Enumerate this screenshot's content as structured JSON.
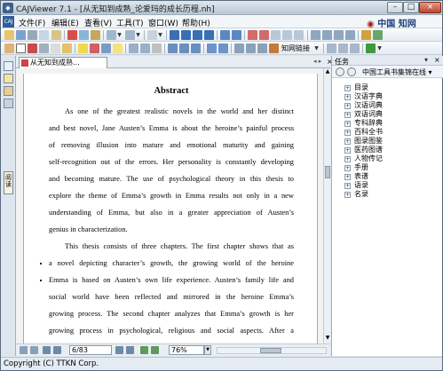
{
  "window": {
    "title": "CAJViewer 7.1 - [从无知到成熟_论爱玛的成长历程.nh]",
    "controls": [
      "–",
      "□",
      "×"
    ]
  },
  "menu": {
    "items": [
      "文件(F)",
      "编辑(E)",
      "查看(V)",
      "工具(T)",
      "窗口(W)",
      "帮助(H)"
    ],
    "brand_cn": "中国",
    "brand_cn2": "知网"
  },
  "toolbar": {
    "hyperlink_label": "知网链接"
  },
  "document": {
    "tab_title": "从无知到成熟...",
    "close_label": "×",
    "nav_label": "◂ ▸",
    "heading": "Abstract",
    "lines": [
      "As one of the greatest realistic novels in the world and her distinct",
      "and best novel, Jane Austen’s Emma is about the heroine’s painful process",
      "of removing illusion into mature and emotional maturity and gaining",
      "self-recognition out of the errors. Her personality is constantly developing",
      "and becoming mature. The use of psychological theory in this thesis to",
      "explore the theme of Emma’s growth in Emma results not only in a new",
      "understanding of Emma, but also in a greater appreciation of Austen’s",
      "genius in characterization.",
      "This thesis consists of three chapters. The first chapter shows that as",
      "a novel depicting character’s growth, the growing world of the heroine",
      "Emma is based on Austen’s own life experience. Austen’s family life and",
      "social world have been reflected and mirrored in the heroine Emma’s",
      "growing process. The second chapter analyzes that Emma’s growth is her",
      "growing process in psychological, religious and social aspects. After a"
    ]
  },
  "left_strip": {
    "read_tab": "阅读"
  },
  "task_panel": {
    "title": "任务",
    "pin": "▾",
    "close": "×",
    "selector": "中国工具书集锦在线 ▾",
    "tree": [
      "目录",
      "汉语字典",
      "汉语词典",
      "双语词典",
      "专科辞典",
      "百科全书",
      "图录图鉴",
      "医药图谱",
      "人物传记",
      "手册",
      "表谱",
      "语录",
      "名录"
    ]
  },
  "navigation": {
    "page_value": "6/83",
    "zoom_value": "76%"
  },
  "status": {
    "text": "Copyright (C) TTKN Corp."
  }
}
